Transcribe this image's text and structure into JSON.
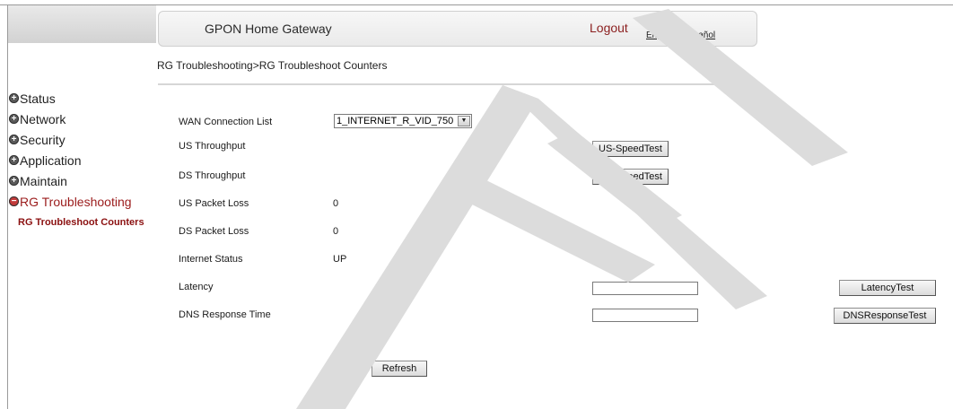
{
  "header": {
    "title": "GPON Home Gateway",
    "logout": "Logout",
    "lang_english": "English",
    "lang_sep": " | ",
    "lang_spanish": "Español"
  },
  "breadcrumb": "RG Troubleshooting>RG Troubleshoot Counters",
  "menu": {
    "items": [
      {
        "label": "Status"
      },
      {
        "label": "Network"
      },
      {
        "label": "Security"
      },
      {
        "label": "Application"
      },
      {
        "label": "Maintain"
      },
      {
        "label": "RG Troubleshooting"
      }
    ],
    "submenu": "RG Troubleshoot Counters"
  },
  "rows": {
    "wan": {
      "label": "WAN Connection List",
      "selected": "1_INTERNET_R_VID_750"
    },
    "us_throughput": {
      "label": "US Throughput",
      "button": "US-SpeedTest"
    },
    "ds_throughput": {
      "label": "DS Throughput",
      "button": "DS-SpeedTest"
    },
    "us_packet_loss": {
      "label": "US Packet Loss",
      "value": "0"
    },
    "ds_packet_loss": {
      "label": "DS Packet Loss",
      "value": "0"
    },
    "internet_status": {
      "label": "Internet Status",
      "value": "UP"
    },
    "latency": {
      "label": "Latency",
      "input_value": "",
      "button": "LatencyTest"
    },
    "dns": {
      "label": "DNS Response Time",
      "input_value": "",
      "button": "DNSResponseTest"
    }
  },
  "refresh_button": "Refresh",
  "watermark_text": "DRAFT",
  "colors": {
    "logout": "#8b1f1f",
    "active_menu": "#9b1c1c",
    "watermark": "#d9d9d9"
  }
}
